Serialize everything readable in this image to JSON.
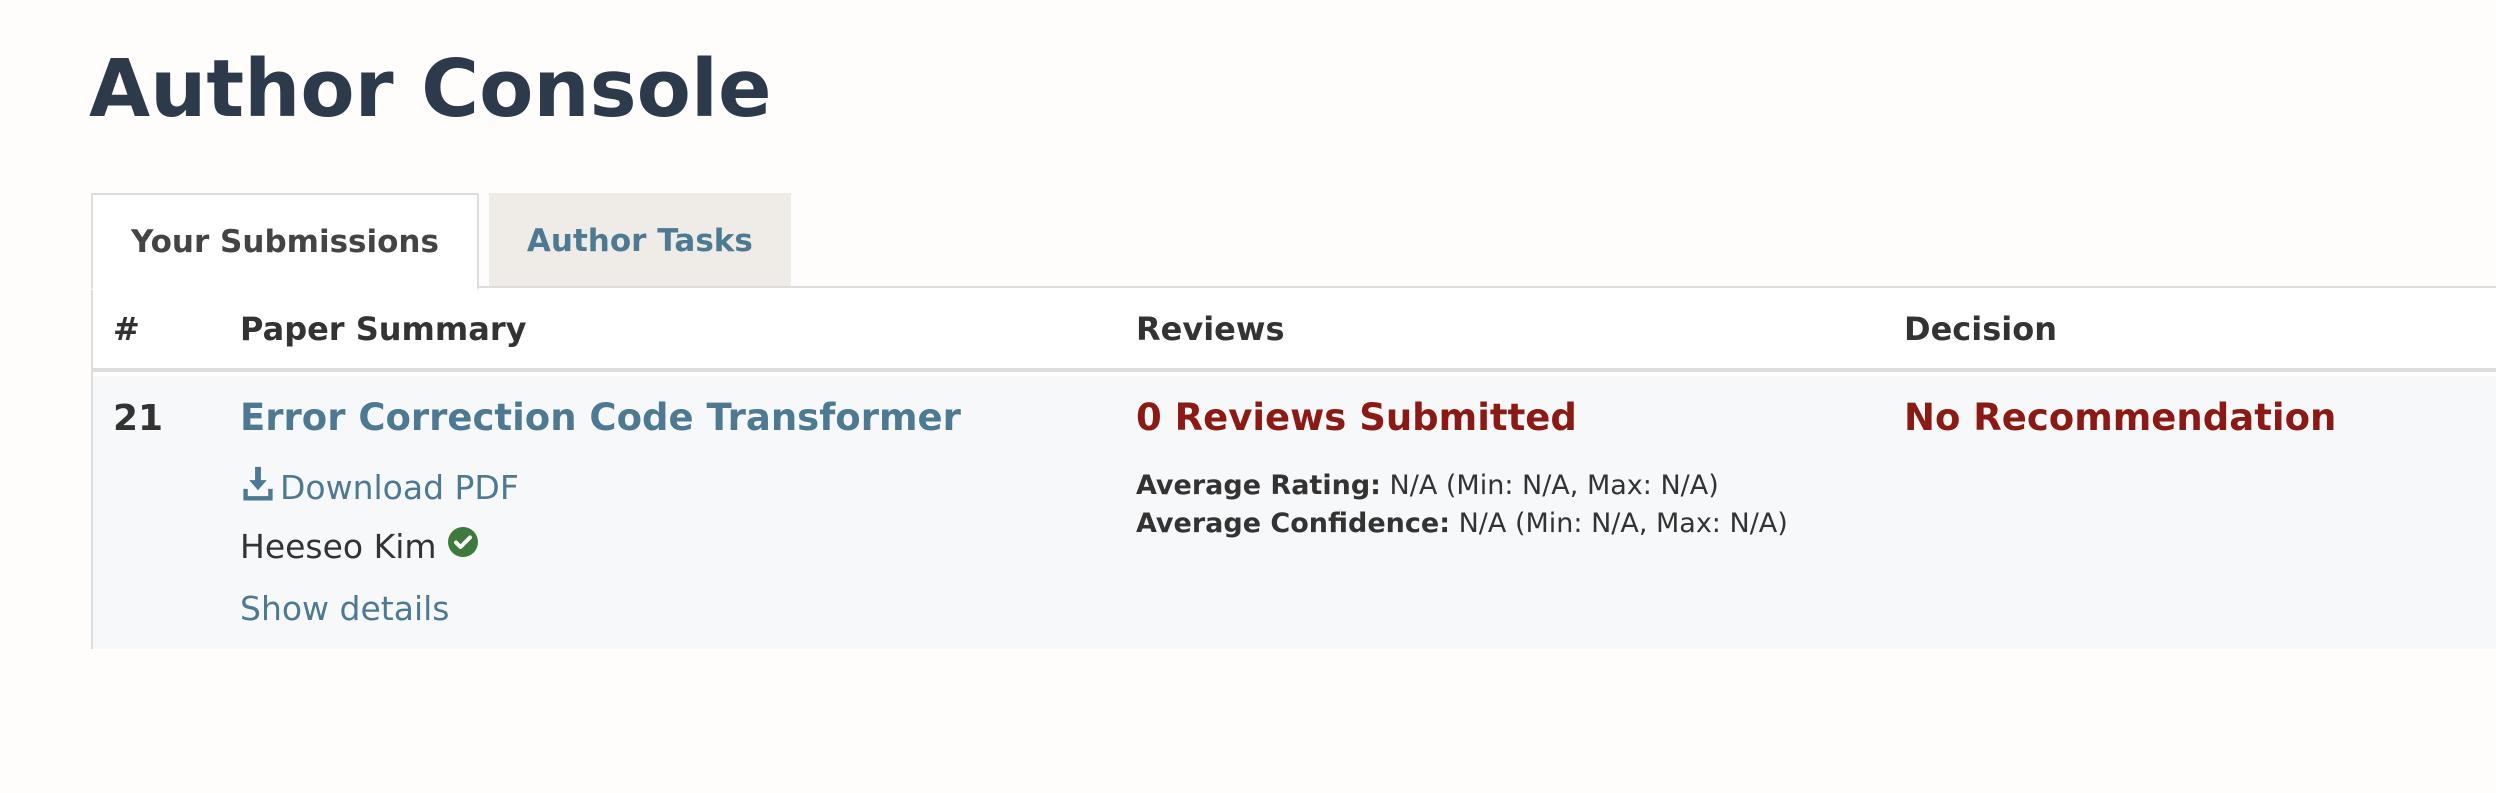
{
  "page": {
    "title": "Author Console"
  },
  "tabs": [
    {
      "label": "Your Submissions",
      "active": true
    },
    {
      "label": "Author Tasks",
      "active": false
    }
  ],
  "table": {
    "columns": [
      "#",
      "Paper Summary",
      "Reviews",
      "Decision"
    ],
    "rows": [
      {
        "number": "21",
        "paper_title": "Error Correction Code Transformer",
        "download_label": "Download PDF",
        "author": "Heeseo Kim",
        "show_details_label": "Show details",
        "reviews_submitted": "0 Reviews Submitted",
        "avg_rating_label": "Average Rating:",
        "avg_rating_value": "N/A (Min: N/A, Max: N/A)",
        "avg_confidence_label": "Average Confidence:",
        "avg_confidence_value": "N/A (Min: N/A, Max: N/A)",
        "decision": "No Recommendation"
      }
    ]
  },
  "icons": {
    "download": "download-icon",
    "verified": "verified-check-icon"
  },
  "colors": {
    "title": "#2c3a4b",
    "link": "#4d7a92",
    "alert": "#8b1a14",
    "verified": "#3e7a3e",
    "inactive_tab_bg": "#efece7"
  }
}
